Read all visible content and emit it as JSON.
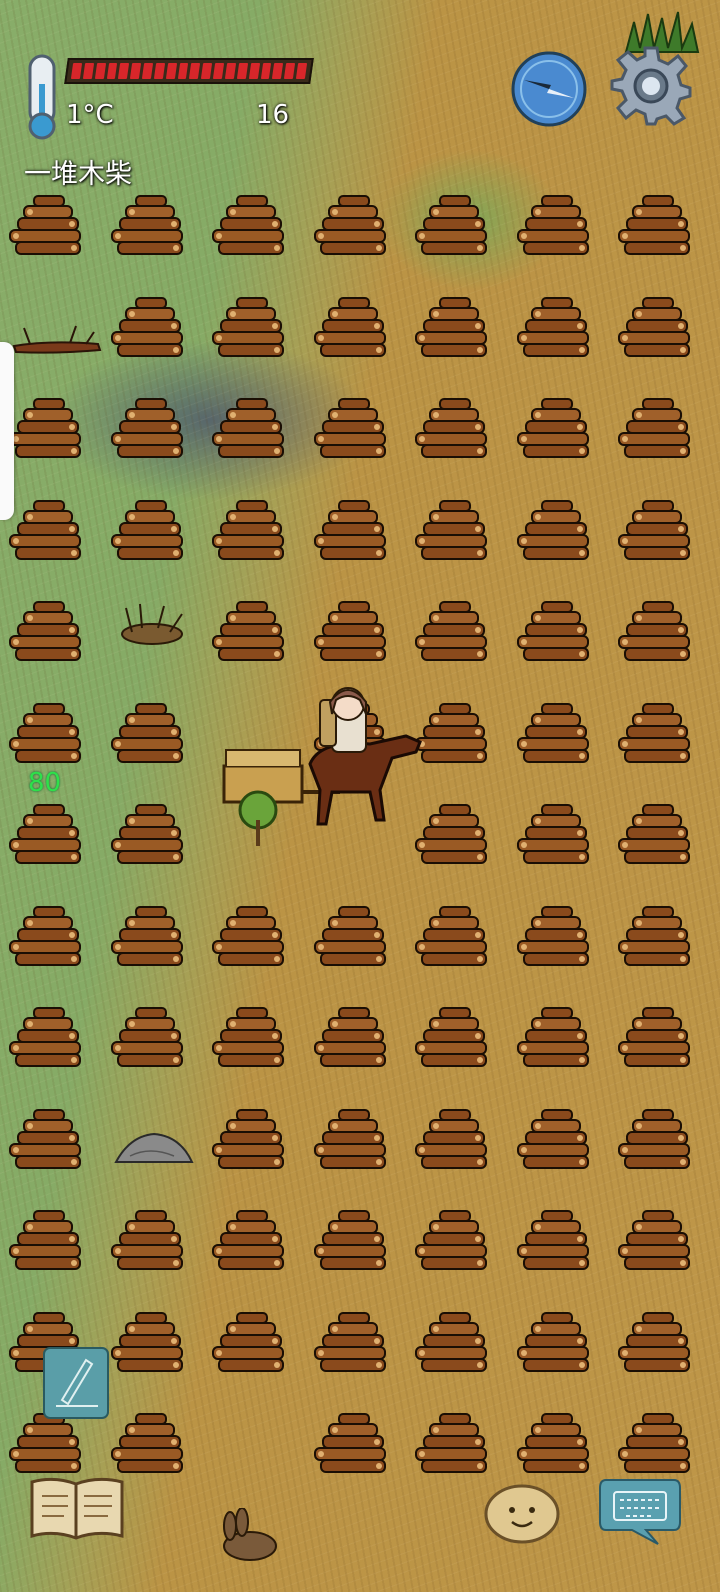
{
  "hud": {
    "temperature": "1°C",
    "food_value": "16",
    "health_segments": 20,
    "hover_label": "一堆木柴",
    "green_number": "80"
  },
  "icons": {
    "thermometer": "thermometer-icon",
    "compass": "compass-icon",
    "settings": "gear-icon",
    "note": "pencil-note-icon",
    "recipe_book": "open-book-icon",
    "emote": "potato-face-icon",
    "chat": "keyboard-chat-icon"
  },
  "colors": {
    "health": "#d8262a",
    "grass": "#86ab66",
    "dirt": "#be9648",
    "hud_text": "#ffffff",
    "green_number": "#2ee04a"
  },
  "map": {
    "tile_item": "一堆木柴",
    "grid_columns": 7,
    "grid_rows": 13,
    "empty_cells": [
      [
        1,
        1,
        0
      ],
      [
        4,
        1,
        0
      ],
      [
        6,
        2,
        0
      ],
      [
        9,
        1,
        0
      ]
    ],
    "special_cells": [
      {
        "row": 1,
        "col": 0,
        "kind": "fallen-log"
      },
      {
        "row": 4,
        "col": 1,
        "kind": "dry-bush"
      },
      {
        "row": 9,
        "col": 1,
        "kind": "flat-rock"
      },
      {
        "row": 12,
        "col": 2,
        "kind": "dead-rabbit"
      }
    ]
  }
}
